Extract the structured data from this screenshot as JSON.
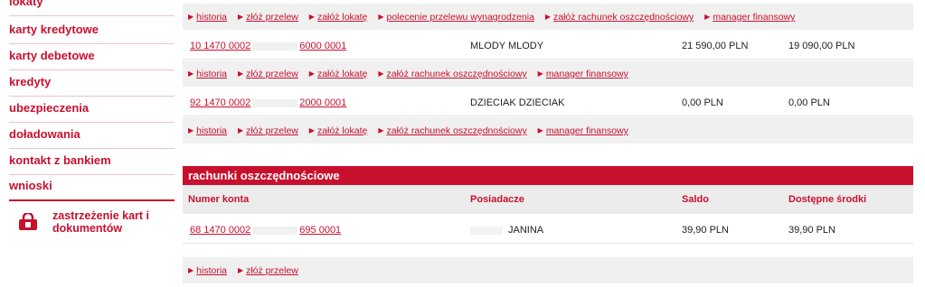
{
  "sidebar": {
    "items": [
      {
        "label": "lokaty"
      },
      {
        "label": "karty kredytowe"
      },
      {
        "label": "karty debetowe"
      },
      {
        "label": "kredyty"
      },
      {
        "label": "ubezpieczenia"
      },
      {
        "label": "doładowania"
      },
      {
        "label": "kontakt z bankiem"
      },
      {
        "label": "wnioski"
      }
    ],
    "special": {
      "line1": "zastrzeżenie kart i",
      "line2": "dokumentów",
      "icon": "lock-icon"
    }
  },
  "accounts": {
    "row0_actions": [
      "historia",
      "złóż przelew",
      "załóż lokatę",
      "polecenie przelewu wynagrodzenia",
      "załóż rachunek oszczędnościowy",
      "manager finansowy"
    ],
    "rows": [
      {
        "number_start": "10 1470 0002",
        "number_end": "6000 0001",
        "holder": "MLODY MLODY",
        "balance": "21 590,00 PLN",
        "available": "19 090,00 PLN",
        "actions": [
          "historia",
          "złóż przelew",
          "załóż lokatę",
          "załóż rachunek oszczędnościowy",
          "manager finansowy"
        ]
      },
      {
        "number_start": "92 1470 0002",
        "number_end": "2000 0001",
        "holder": "DZIECIAK DZIECIAK",
        "balance": "0,00 PLN",
        "available": "0,00 PLN",
        "actions": [
          "historia",
          "złóż przelew",
          "załóż lokatę",
          "załóż rachunek oszczędnościowy",
          "manager finansowy"
        ]
      }
    ]
  },
  "savings": {
    "title": "rachunki oszczędnościowe",
    "columns": {
      "number": "Numer konta",
      "holders": "Posiadacze",
      "balance": "Saldo",
      "available": "Dostępne środki"
    },
    "row": {
      "number_start": "68 1470 0002",
      "number_end": "695 0001",
      "holder": "JANINA",
      "balance": "39,90 PLN",
      "available": "39,90 PLN",
      "actions": [
        "historia",
        "złóż przelew"
      ]
    }
  },
  "colors": {
    "accent": "#c8102e",
    "row_bg": "#f0f0f0",
    "header_bg": "#ececec"
  }
}
